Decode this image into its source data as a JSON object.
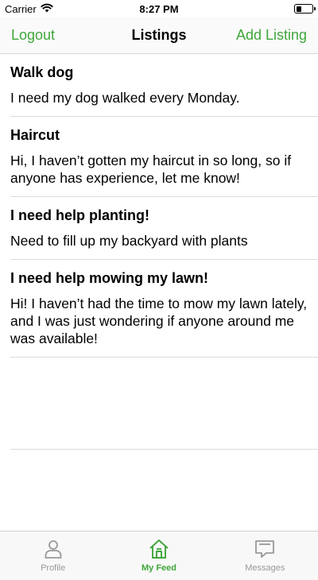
{
  "status_bar": {
    "carrier": "Carrier",
    "time": "8:27 PM",
    "battery_level": 0.35
  },
  "nav": {
    "left_button": "Logout",
    "title": "Listings",
    "right_button": "Add Listing"
  },
  "listings": [
    {
      "title": "Walk dog",
      "body": "I need my dog walked every Monday."
    },
    {
      "title": "Haircut",
      "body": "Hi, I haven’t gotten my haircut in so long, so if anyone has experience, let me know!"
    },
    {
      "title": "I need help planting!",
      "body": "Need to fill up my backyard with plants"
    },
    {
      "title": "I need help mowing my lawn!",
      "body": "Hi! I haven’t had the time to mow my lawn lately, and I was just wondering if anyone around me was available!"
    }
  ],
  "tabs": [
    {
      "label": "Profile",
      "icon": "person-icon",
      "active": false
    },
    {
      "label": "My Feed",
      "icon": "home-icon",
      "active": true
    },
    {
      "label": "Messages",
      "icon": "chat-icon",
      "active": false
    }
  ],
  "colors": {
    "accent": "#3fa63a",
    "inactive": "#999999"
  }
}
